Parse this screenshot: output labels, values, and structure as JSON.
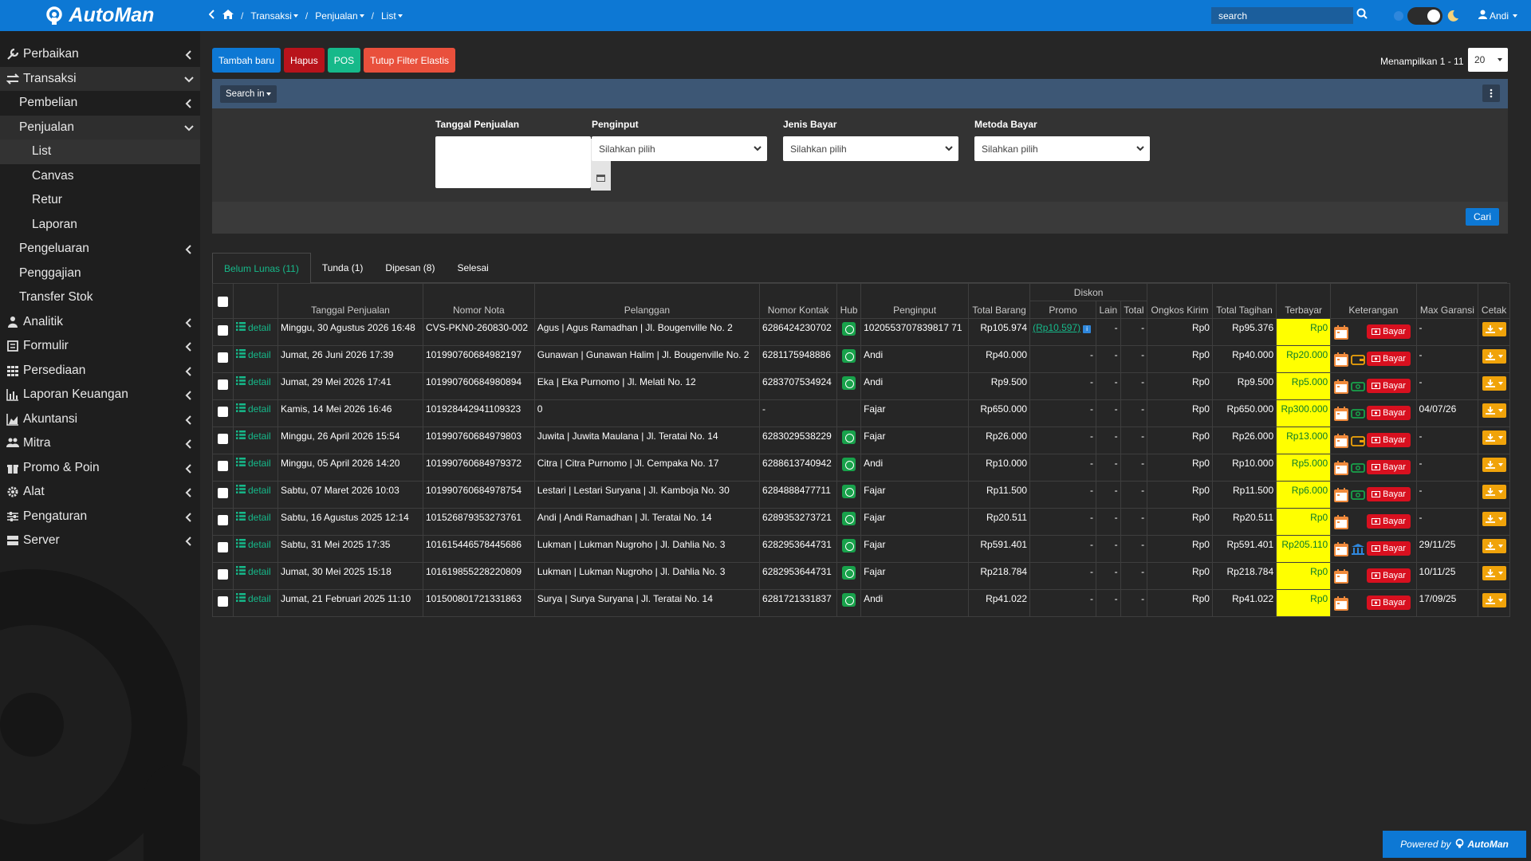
{
  "app": {
    "brand": "AutoMan",
    "powered_prefix": "Powered by",
    "powered_brand": "AutoMan"
  },
  "topbar": {
    "breadcrumbs": [
      "Transaksi",
      "Penjualan",
      "List"
    ],
    "search_placeholder": "search",
    "user": "Andi"
  },
  "sidebar": {
    "items": [
      {
        "label": "Perbaikan",
        "icon": "wrench-icon",
        "level": 1,
        "chevron": "left"
      },
      {
        "label": "Transaksi",
        "icon": "exchange-icon",
        "level": 1,
        "chevron": "down",
        "active": true
      },
      {
        "label": "Pembelian",
        "level": 2,
        "chevron": "left"
      },
      {
        "label": "Penjualan",
        "level": 2,
        "chevron": "down",
        "active": true
      },
      {
        "label": "List",
        "level": 3,
        "active": true
      },
      {
        "label": "Canvas",
        "level": 3
      },
      {
        "label": "Retur",
        "level": 3
      },
      {
        "label": "Laporan",
        "level": 3
      },
      {
        "label": "Pengeluaran",
        "level": 2,
        "chevron": "left"
      },
      {
        "label": "Penggajian",
        "level": 2
      },
      {
        "label": "Transfer Stok",
        "level": 2
      },
      {
        "label": "Analitik",
        "icon": "user-icon",
        "level": 1,
        "chevron": "left"
      },
      {
        "label": "Formulir",
        "icon": "form-icon",
        "level": 1,
        "chevron": "left"
      },
      {
        "label": "Persediaan",
        "icon": "grid-icon",
        "level": 1,
        "chevron": "left"
      },
      {
        "label": "Laporan Keuangan",
        "icon": "bar-chart-icon",
        "level": 1,
        "chevron": "left"
      },
      {
        "label": "Akuntansi",
        "icon": "area-chart-icon",
        "level": 1,
        "chevron": "left"
      },
      {
        "label": "Mitra",
        "icon": "users-icon",
        "level": 1,
        "chevron": "left"
      },
      {
        "label": "Promo & Poin",
        "icon": "gift-icon",
        "level": 1,
        "chevron": "left"
      },
      {
        "label": "Alat",
        "icon": "cog-icon",
        "level": 1,
        "chevron": "left"
      },
      {
        "label": "Pengaturan",
        "icon": "sliders-icon",
        "level": 1,
        "chevron": "left"
      },
      {
        "label": "Server",
        "icon": "server-icon",
        "level": 1,
        "chevron": "left"
      }
    ]
  },
  "toolbar": {
    "tambah": "Tambah baru",
    "hapus": "Hapus",
    "pos": "POS",
    "tutup": "Tutup Filter Elastis",
    "showing": "Menampilkan 1 - 11",
    "per_page": "20"
  },
  "filter": {
    "search_in": "Search in",
    "tanggal_label": "Tanggal Penjualan",
    "penginput_label": "Penginput",
    "penginput_value": "Silahkan pilih",
    "jenis_label": "Jenis Bayar",
    "jenis_value": "Silahkan pilih",
    "metoda_label": "Metoda Bayar",
    "metoda_value": "Silahkan pilih",
    "cari": "Cari"
  },
  "tabs": [
    {
      "label": "Belum Lunas (11)",
      "active": true
    },
    {
      "label": "Tunda (1)"
    },
    {
      "label": "Dipesan (8)"
    },
    {
      "label": "Selesai"
    }
  ],
  "table": {
    "group_header": "Diskon",
    "headers": {
      "tanggal": "Tanggal Penjualan",
      "nota": "Nomor Nota",
      "pelanggan": "Pelanggan",
      "kontak": "Nomor Kontak",
      "hub": "Hub",
      "penginput": "Penginput",
      "total_barang": "Total Barang",
      "promo": "Promo",
      "lain": "Lain",
      "total": "Total",
      "ongkos": "Ongkos Kirim",
      "tagihan": "Total Tagihan",
      "terbayar": "Terbayar",
      "keterangan": "Keterangan",
      "garansi": "Max Garansi",
      "cetak": "Cetak"
    },
    "detail_label": "detail",
    "bayar_label": "Bayar",
    "rows": [
      {
        "tanggal": "Minggu, 30 Agustus 2026 16:48",
        "nota": "CVS-PKN0-260830-002",
        "pelanggan": "Agus | Agus Ramadhan | Jl. Bougenville No. 2",
        "kontak": "6286424230702",
        "wa": true,
        "penginput": "1020553707839817 71",
        "total_barang": "Rp105.974",
        "promo": "(Rp10.597)",
        "lain": "-",
        "total": "-",
        "ongkos": "Rp0",
        "tagihan": "Rp95.376",
        "terbayar": "Rp0",
        "pay_icon": "",
        "garansi": "-"
      },
      {
        "tanggal": "Jumat, 26 Juni 2026 17:39",
        "nota": "101990760684982197",
        "pelanggan": "Gunawan | Gunawan Halim | Jl. Bougenville No. 2",
        "kontak": "6281175948886",
        "wa": true,
        "penginput": "Andi",
        "total_barang": "Rp40.000",
        "promo": "-",
        "lain": "-",
        "total": "-",
        "ongkos": "Rp0",
        "tagihan": "Rp40.000",
        "terbayar": "Rp20.000",
        "pay_icon": "wallet",
        "garansi": "-"
      },
      {
        "tanggal": "Jumat, 29 Mei 2026 17:41",
        "nota": "101990760684980894",
        "pelanggan": "Eka | Eka Purnomo | Jl. Melati No. 12",
        "kontak": "6283707534924",
        "wa": true,
        "penginput": "Andi",
        "total_barang": "Rp9.500",
        "promo": "-",
        "lain": "-",
        "total": "-",
        "ongkos": "Rp0",
        "tagihan": "Rp9.500",
        "terbayar": "Rp5.000",
        "pay_icon": "cash",
        "garansi": "-"
      },
      {
        "tanggal": "Kamis, 14 Mei 2026 16:46",
        "nota": "101928442941109323",
        "pelanggan": "0",
        "kontak": "-",
        "wa": false,
        "penginput": "Fajar",
        "total_barang": "Rp650.000",
        "promo": "-",
        "lain": "-",
        "total": "-",
        "ongkos": "Rp0",
        "tagihan": "Rp650.000",
        "terbayar": "Rp300.000",
        "pay_icon": "cash",
        "garansi": "04/07/26"
      },
      {
        "tanggal": "Minggu, 26 April 2026 15:54",
        "nota": "101990760684979803",
        "pelanggan": "Juwita | Juwita Maulana | Jl. Teratai No. 14",
        "kontak": "6283029538229",
        "wa": true,
        "penginput": "Fajar",
        "total_barang": "Rp26.000",
        "promo": "-",
        "lain": "-",
        "total": "-",
        "ongkos": "Rp0",
        "tagihan": "Rp26.000",
        "terbayar": "Rp13.000",
        "pay_icon": "wallet",
        "garansi": "-"
      },
      {
        "tanggal": "Minggu, 05 April 2026 14:20",
        "nota": "101990760684979372",
        "pelanggan": "Citra | Citra Purnomo | Jl. Cempaka No. 17",
        "kontak": "6288613740942",
        "wa": true,
        "penginput": "Andi",
        "total_barang": "Rp10.000",
        "promo": "-",
        "lain": "-",
        "total": "-",
        "ongkos": "Rp0",
        "tagihan": "Rp10.000",
        "terbayar": "Rp5.000",
        "pay_icon": "cash",
        "garansi": "-"
      },
      {
        "tanggal": "Sabtu, 07 Maret 2026 10:03",
        "nota": "101990760684978754",
        "pelanggan": "Lestari | Lestari Suryana | Jl. Kamboja No. 30",
        "kontak": "6284888477711",
        "wa": true,
        "penginput": "Fajar",
        "total_barang": "Rp11.500",
        "promo": "-",
        "lain": "-",
        "total": "-",
        "ongkos": "Rp0",
        "tagihan": "Rp11.500",
        "terbayar": "Rp6.000",
        "pay_icon": "cash",
        "garansi": "-"
      },
      {
        "tanggal": "Sabtu, 16 Agustus 2025 12:14",
        "nota": "101526879353273761",
        "pelanggan": "Andi | Andi Ramadhan | Jl. Teratai No. 14",
        "kontak": "6289353273721",
        "wa": true,
        "penginput": "Fajar",
        "total_barang": "Rp20.511",
        "promo": "-",
        "lain": "-",
        "total": "-",
        "ongkos": "Rp0",
        "tagihan": "Rp20.511",
        "terbayar": "Rp0",
        "pay_icon": "",
        "garansi": "-"
      },
      {
        "tanggal": "Sabtu, 31 Mei 2025 17:35",
        "nota": "101615446578445686",
        "pelanggan": "Lukman | Lukman Nugroho | Jl. Dahlia No. 3",
        "kontak": "6282953644731",
        "wa": true,
        "penginput": "Fajar",
        "total_barang": "Rp591.401",
        "promo": "-",
        "lain": "-",
        "total": "-",
        "ongkos": "Rp0",
        "tagihan": "Rp591.401",
        "terbayar": "Rp205.110",
        "pay_icon": "bank",
        "garansi": "29/11/25"
      },
      {
        "tanggal": "Jumat, 30 Mei 2025 15:18",
        "nota": "101619855228220809",
        "pelanggan": "Lukman | Lukman Nugroho | Jl. Dahlia No. 3",
        "kontak": "6282953644731",
        "wa": true,
        "penginput": "Fajar",
        "total_barang": "Rp218.784",
        "promo": "-",
        "lain": "-",
        "total": "-",
        "ongkos": "Rp0",
        "tagihan": "Rp218.784",
        "terbayar": "Rp0",
        "pay_icon": "",
        "garansi": "10/11/25"
      },
      {
        "tanggal": "Jumat, 21 Februari 2025 11:10",
        "nota": "101500801721331863",
        "pelanggan": "Surya | Surya Suryana | Jl. Teratai No. 14",
        "kontak": "6281721331837",
        "wa": true,
        "penginput": "Andi",
        "total_barang": "Rp41.022",
        "promo": "-",
        "lain": "-",
        "total": "-",
        "ongkos": "Rp0",
        "tagihan": "Rp41.022",
        "terbayar": "Rp0",
        "pay_icon": "",
        "garansi": "17/09/25"
      }
    ]
  }
}
